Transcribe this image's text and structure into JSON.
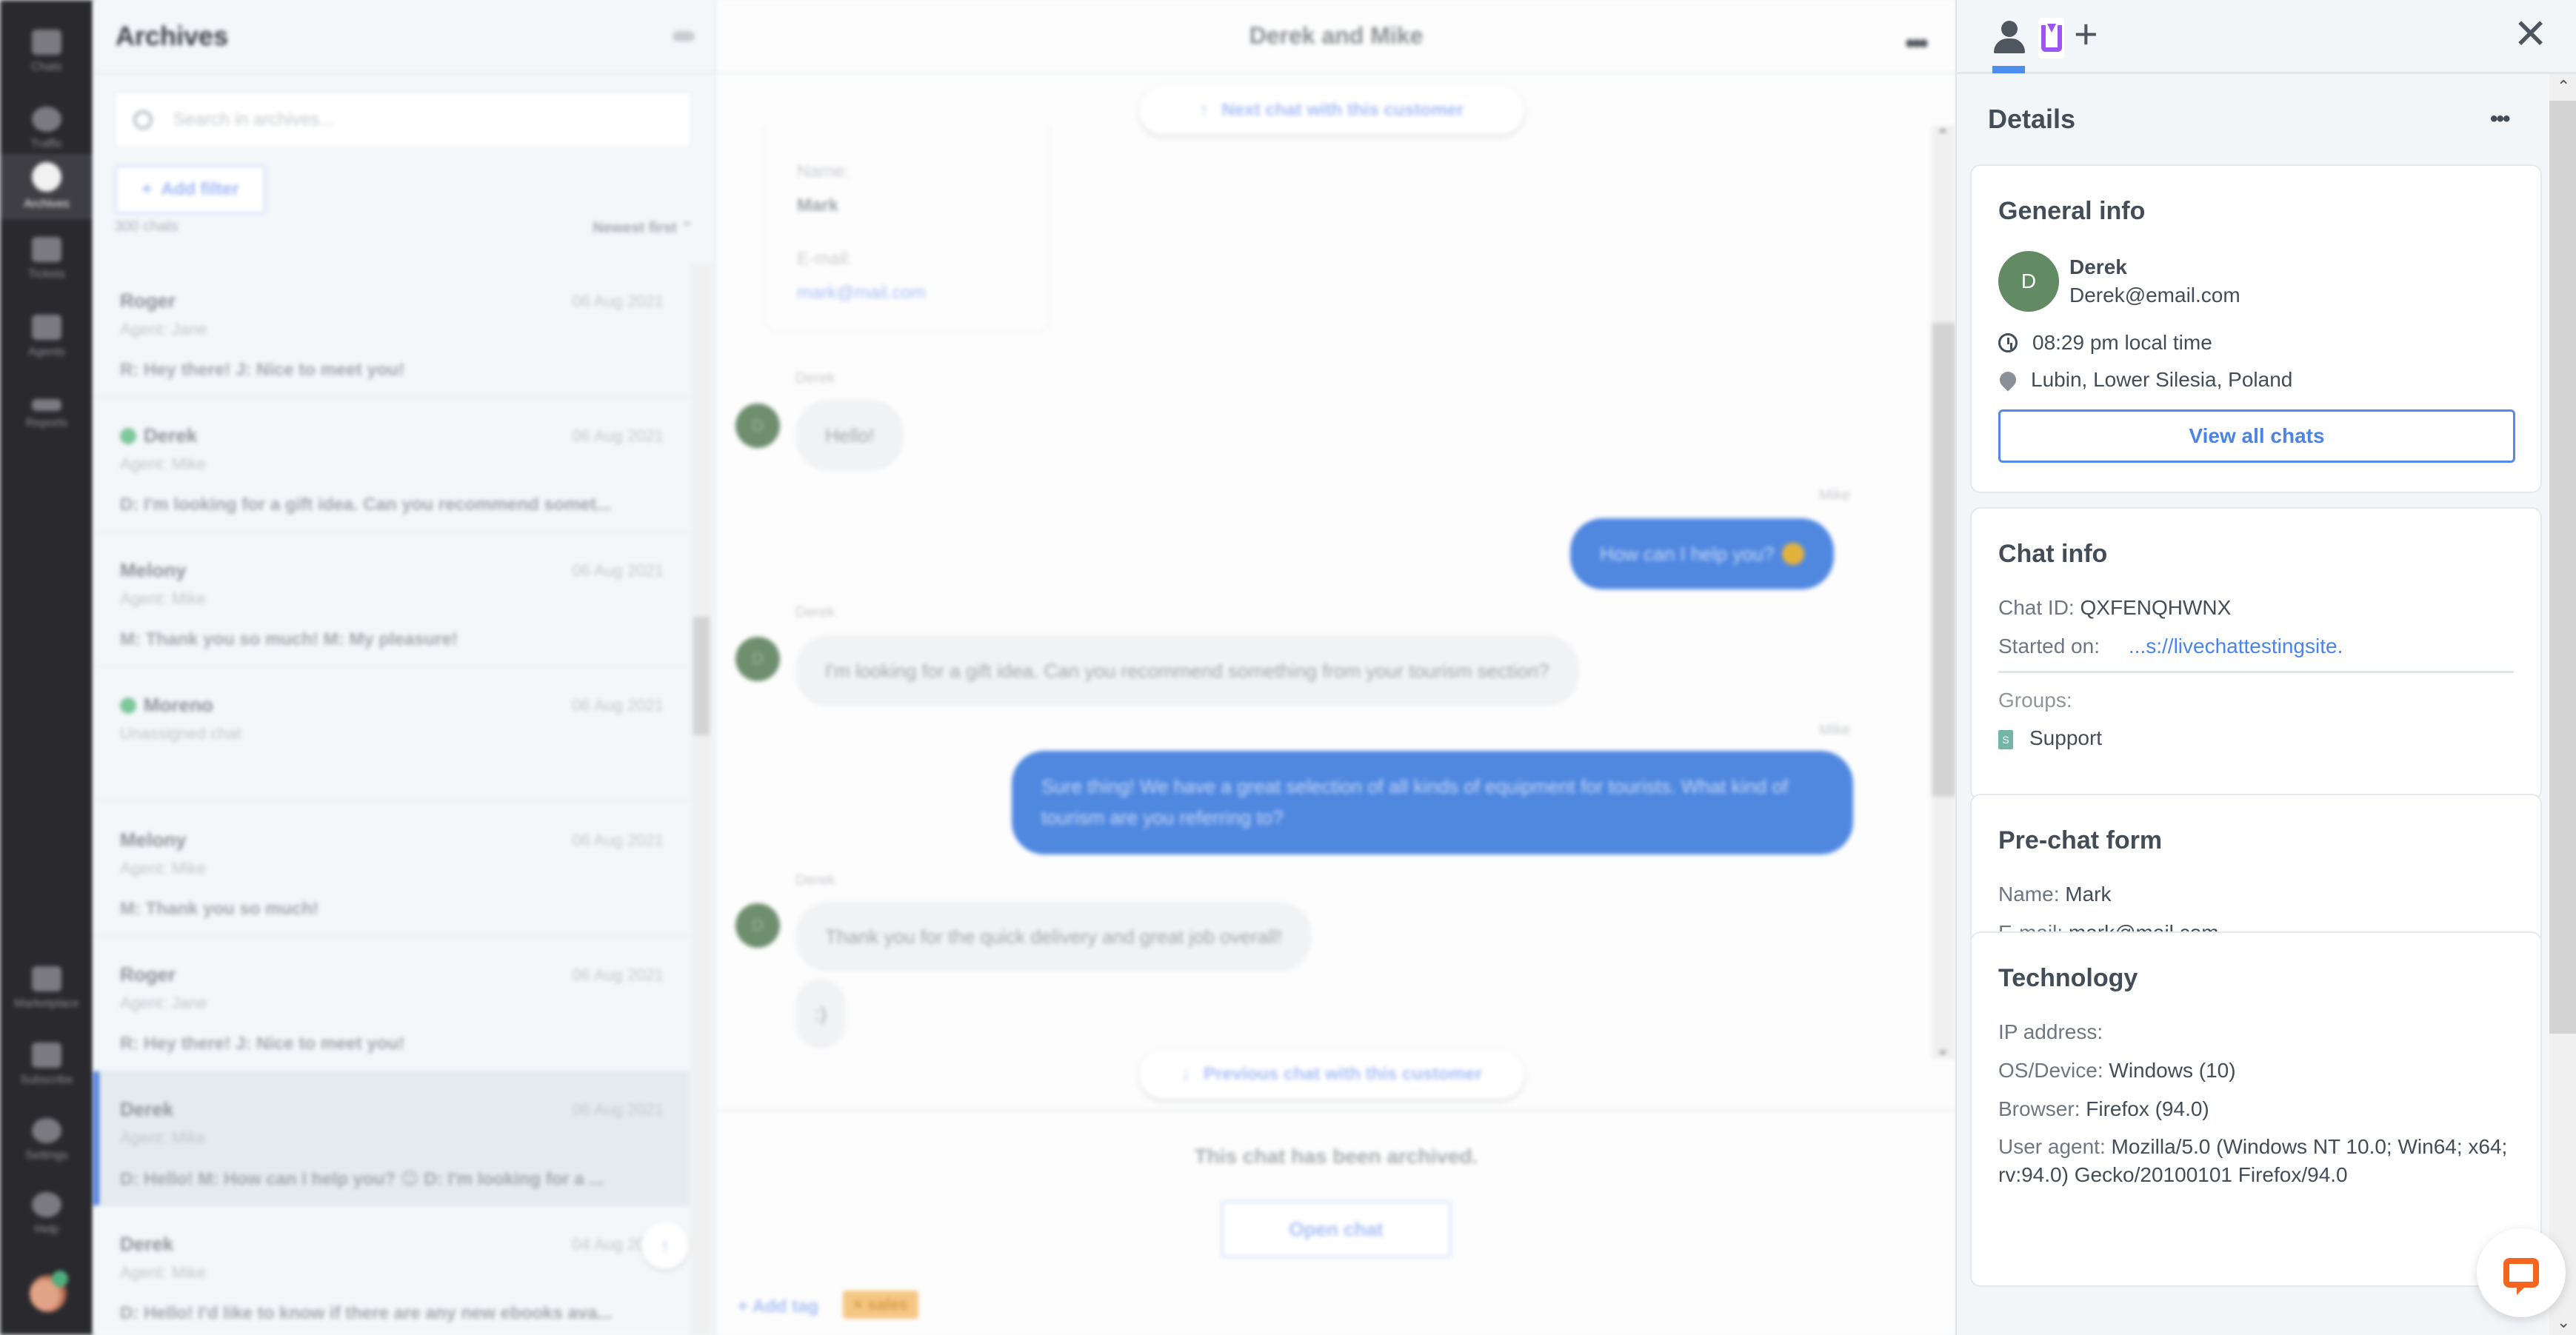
{
  "nav": {
    "items": [
      {
        "label": "Chats",
        "icon": "chats-icon"
      },
      {
        "label": "Traffic",
        "icon": "traffic-icon"
      },
      {
        "label": "Archives",
        "icon": "archives-icon",
        "active": true
      },
      {
        "label": "Tickets",
        "icon": "tickets-icon"
      },
      {
        "label": "Agents",
        "icon": "agents-icon"
      },
      {
        "label": "Reports",
        "icon": "reports-icon"
      }
    ],
    "bottom_items": [
      {
        "label": "Marketplace",
        "icon": "marketplace-icon"
      },
      {
        "label": "Subscribe",
        "icon": "subscribe-icon"
      },
      {
        "label": "Settings",
        "icon": "settings-icon"
      },
      {
        "label": "Help",
        "icon": "help-icon"
      }
    ]
  },
  "archives": {
    "title": "Archives",
    "search_placeholder": "Search in archives...",
    "add_filter": "Add filter",
    "count": "300 chats",
    "sort": "Newest first",
    "items": [
      {
        "name": "Roger",
        "date": "06 Aug 2021",
        "agent": "Agent: Jane",
        "preview": "R: Hey there! J: Nice to meet you!",
        "online": false
      },
      {
        "name": "Derek",
        "date": "06 Aug 2021",
        "agent": "Agent: Mike",
        "preview": "D: I'm looking for a gift idea. Can you recommend somet...",
        "online": true
      },
      {
        "name": "Melony",
        "date": "06 Aug 2021",
        "agent": "Agent: Mike",
        "preview": "M: Thank you so much! M: My pleasure!",
        "online": false
      },
      {
        "name": "Moreno",
        "date": "06 Aug 2021",
        "agent": "Unassigned chat",
        "preview": "",
        "online": true
      },
      {
        "name": "Melony",
        "date": "06 Aug 2021",
        "agent": "Agent: Mike",
        "preview": "M: Thank you so much!",
        "online": false
      },
      {
        "name": "Roger",
        "date": "06 Aug 2021",
        "agent": "Agent: Jane",
        "preview": "R: Hey there! J: Nice to meet you!",
        "online": false
      },
      {
        "name": "Derek",
        "date": "06 Aug 2021",
        "agent": "Agent: Mike",
        "preview": "D: Hello! M: How can I help you? 😊 D: I'm looking for a ...",
        "online": false,
        "selected": true
      },
      {
        "name": "Derek",
        "date": "04 Aug 2021",
        "agent": "Agent: Mike",
        "preview": "D: Hello! I'd like to know if there are any new ebooks ava...",
        "online": false
      }
    ]
  },
  "chat": {
    "title": "Derek and Mike",
    "next_chat": "Next chat with this customer",
    "prev_chat": "Previous chat with this customer",
    "prechat": {
      "name_label": "Name:",
      "name": "Mark",
      "email_label": "E-mail:",
      "email": "mark@mail.com"
    },
    "messages": [
      {
        "sender": "Derek",
        "text": "Hello!",
        "dir": "in"
      },
      {
        "sender": "Mike",
        "text": "How can I help you?",
        "dir": "out",
        "emoji": true
      },
      {
        "sender": "Derek",
        "text": "I'm looking for a gift idea. Can you recommend something from your tourism section?",
        "dir": "in"
      },
      {
        "sender": "Mike",
        "text": "Sure thing! We have a great selection of all kinds of equipment for tourists. What kind of tourism are you referring to?",
        "dir": "out"
      },
      {
        "sender": "Derek",
        "text": "Thank you for the quick delivery and great job overall!",
        "dir": "in"
      },
      {
        "sender": "",
        "text": ":)",
        "dir": "in"
      }
    ],
    "archived_notice": "This chat has been archived.",
    "open_chat": "Open chat",
    "add_tag": "+ Add tag",
    "tags": [
      "sales"
    ]
  },
  "details": {
    "title": "Details",
    "general": {
      "heading": "General info",
      "avatar_initial": "D",
      "name": "Derek",
      "email": "Derek@email.com",
      "local_time": "08:29 pm local time",
      "location": "Lubin, Lower Silesia, Poland",
      "view_all": "View all chats"
    },
    "chat_info": {
      "heading": "Chat info",
      "chat_id_label": "Chat ID:",
      "chat_id": "QXFENQHWNX",
      "started_label": "Started on:",
      "started_url": "...s://livechattestingsite.",
      "groups_label": "Groups:",
      "group_initial": "S",
      "group": "Support"
    },
    "prechat": {
      "heading": "Pre-chat form",
      "name_label": "Name:",
      "name": "Mark",
      "email_label": "E-mail:",
      "email": "mark@mail.com"
    },
    "technology": {
      "heading": "Technology",
      "ip_label": "IP address:",
      "ip": "",
      "os_label": "OS/Device:",
      "os": "Windows (10)",
      "browser_label": "Browser:",
      "browser": "Firefox (94.0)",
      "ua_label": "User agent:",
      "ua": "Mozilla/5.0 (Windows NT 10.0; Win64; x64; rv:94.0) Gecko/20100101 Firefox/94.0"
    }
  },
  "colors": {
    "accent": "#4a84e9",
    "nav_bg": "#29292e",
    "customer_avatar": "#628a63",
    "outgoing_bubble": "#5088e0",
    "tag": "#f5c784",
    "livechat_brand": "#f5651f",
    "app_tab": "#9d54f5"
  }
}
